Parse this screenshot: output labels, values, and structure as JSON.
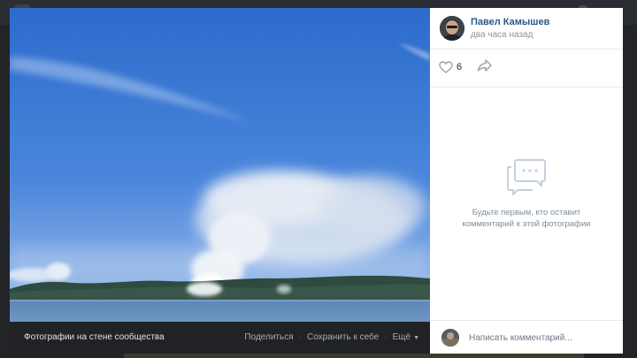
{
  "post": {
    "author_name": "Павел Камышев",
    "time": "два часа назад",
    "likes": "6"
  },
  "photo_bar": {
    "album_link": "Фотографии на стене сообщества",
    "share_label": "Поделиться",
    "save_label": "Сохранить к себе",
    "more_label": "Ещё"
  },
  "comments": {
    "empty_text": "Будьте первым, кто оставит комментарий к этой фотографии",
    "placeholder": "Написать комментарий..."
  },
  "icons": {
    "like": "heart-icon",
    "share": "share-arrow-icon",
    "empty": "comments-bubble-icon",
    "more": "chevron-down-icon"
  },
  "colors": {
    "link": "#2a5885",
    "muted": "#818c99",
    "sky_top": "#2d6dce",
    "sky_bottom": "#8fb3e8",
    "bar": "#212225"
  }
}
